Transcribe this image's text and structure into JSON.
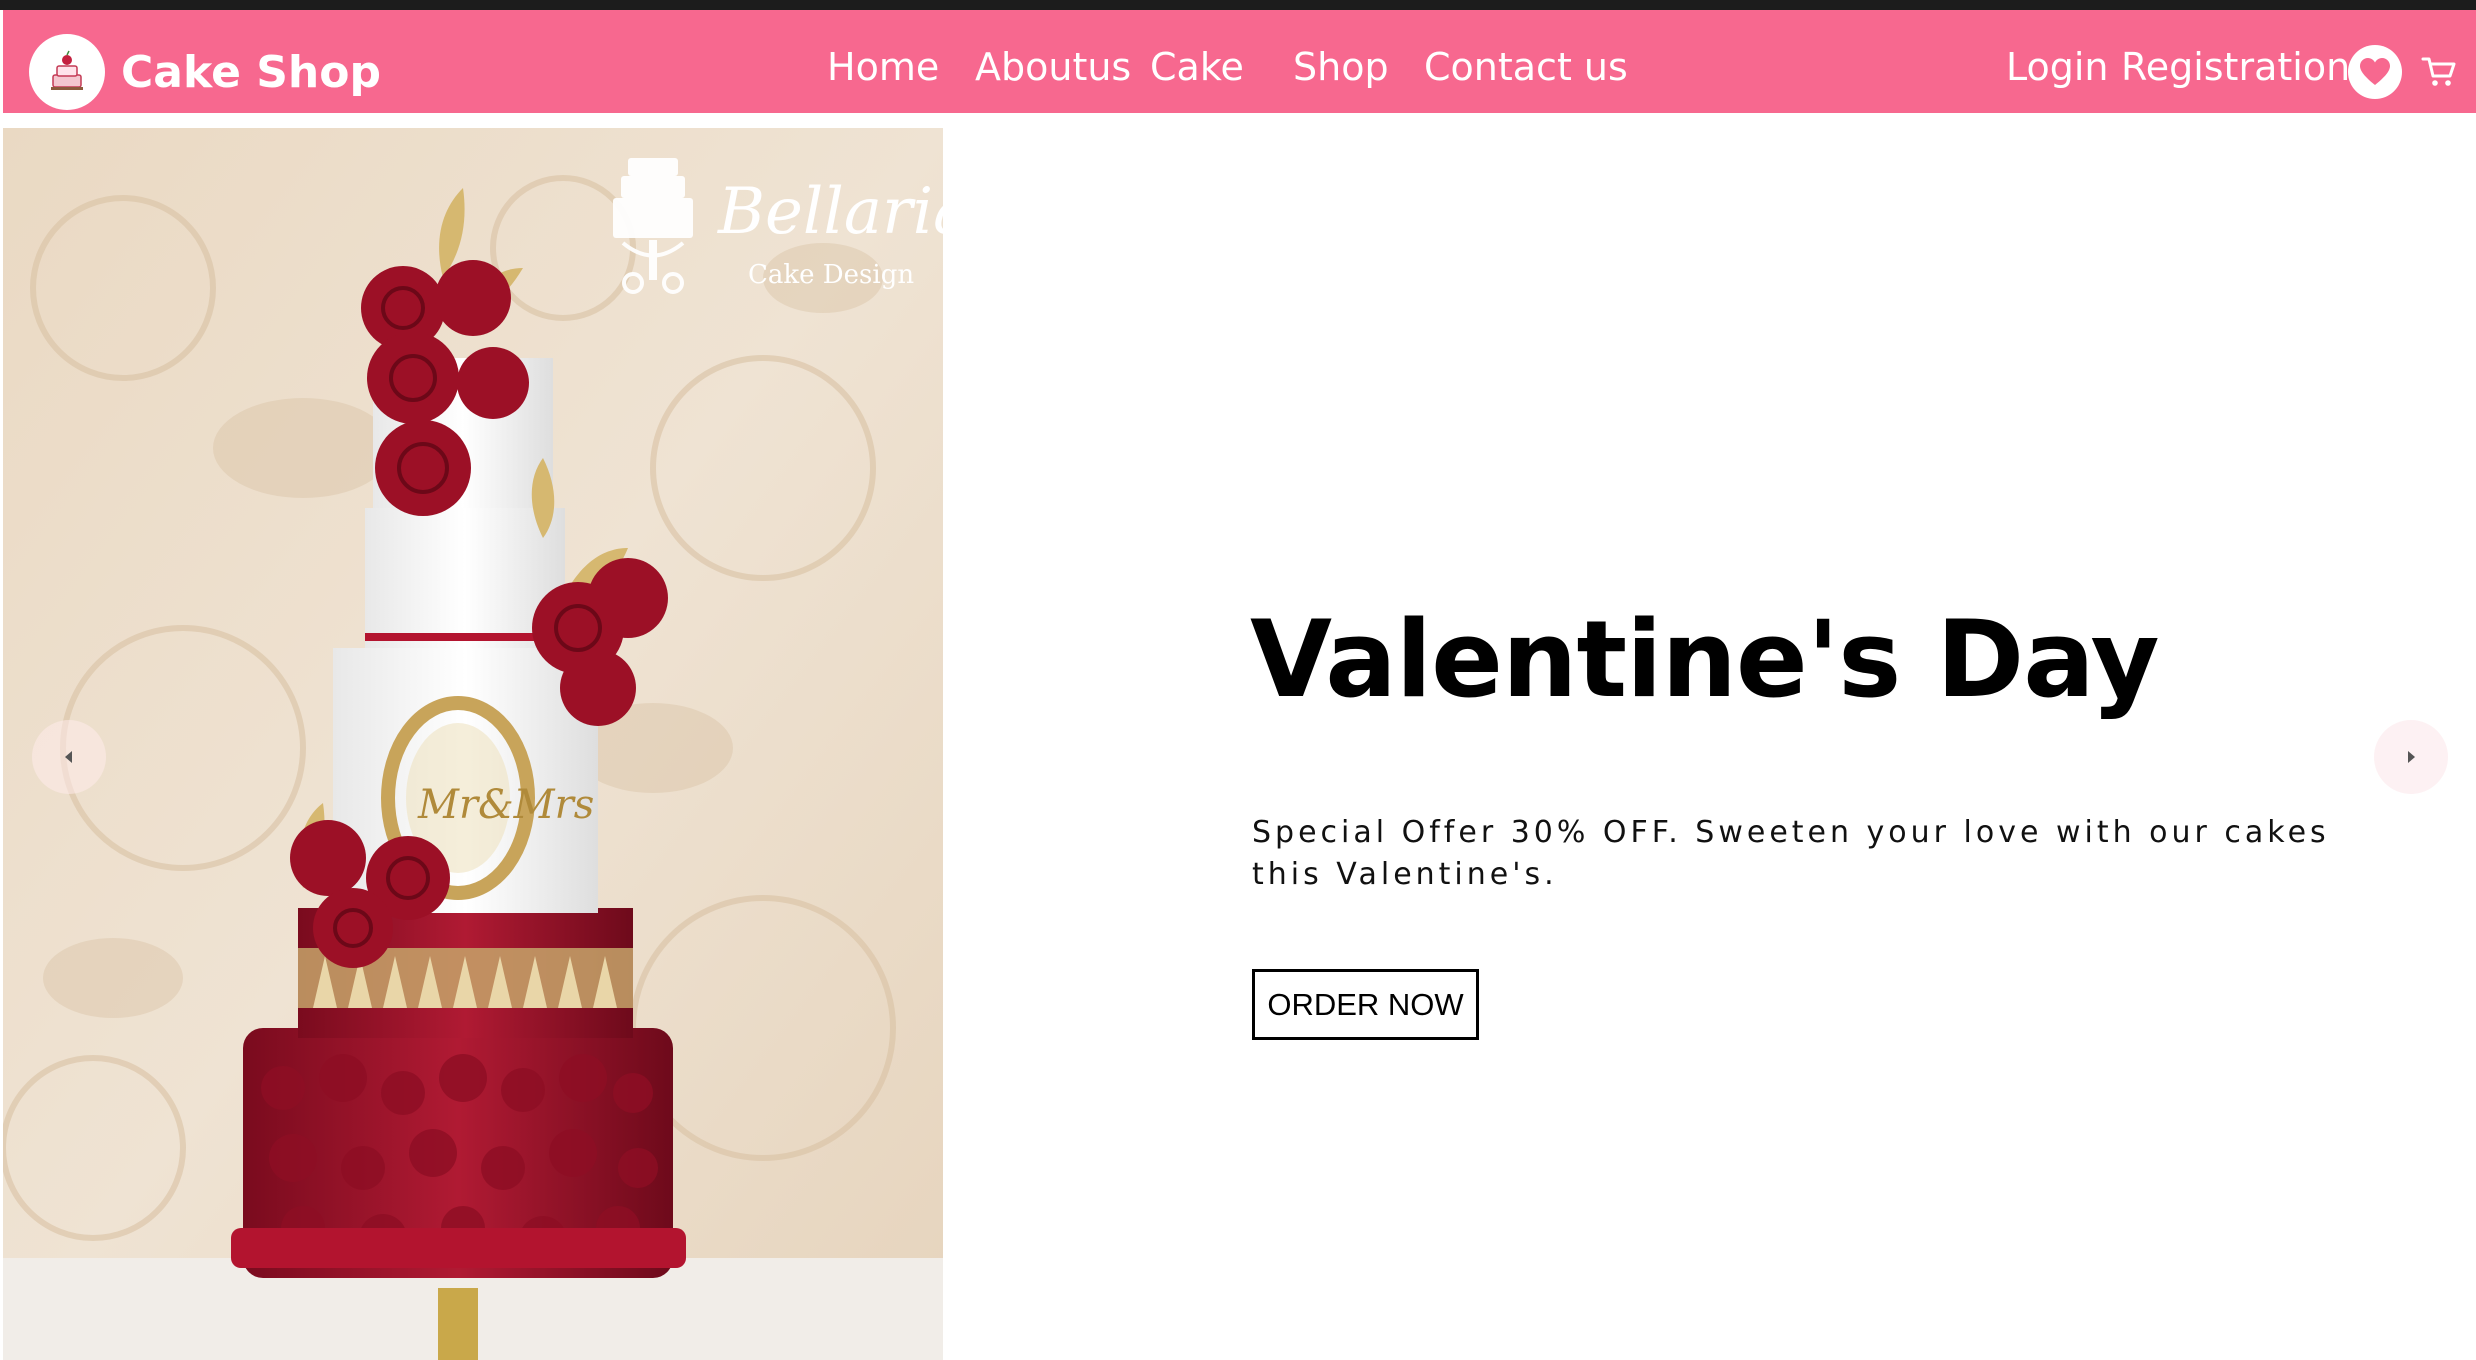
{
  "brand": {
    "name": "Cake Shop",
    "logo_icon": "cake-logo-icon"
  },
  "nav": {
    "links": [
      "Home",
      "Aboutus",
      "Cake",
      "Shop",
      "Contact us"
    ],
    "login": "Login",
    "registration": "Registration",
    "wishlist_icon": "heart-icon",
    "cart_icon": "cart-icon"
  },
  "hero": {
    "image_watermark_name": "Bellaria",
    "image_watermark_sub": "Cake Design",
    "title": "Valentine's Day",
    "text": "Special Offer 30% OFF. Sweeten your love with our cakes this Valentine's.",
    "button": "ORDER NOW",
    "prev_icon": "caret-left-icon",
    "next_icon": "caret-right-icon"
  },
  "colors": {
    "navbar": "#f7688f",
    "cake_red": "#9c1026",
    "background": "#ffffff"
  }
}
